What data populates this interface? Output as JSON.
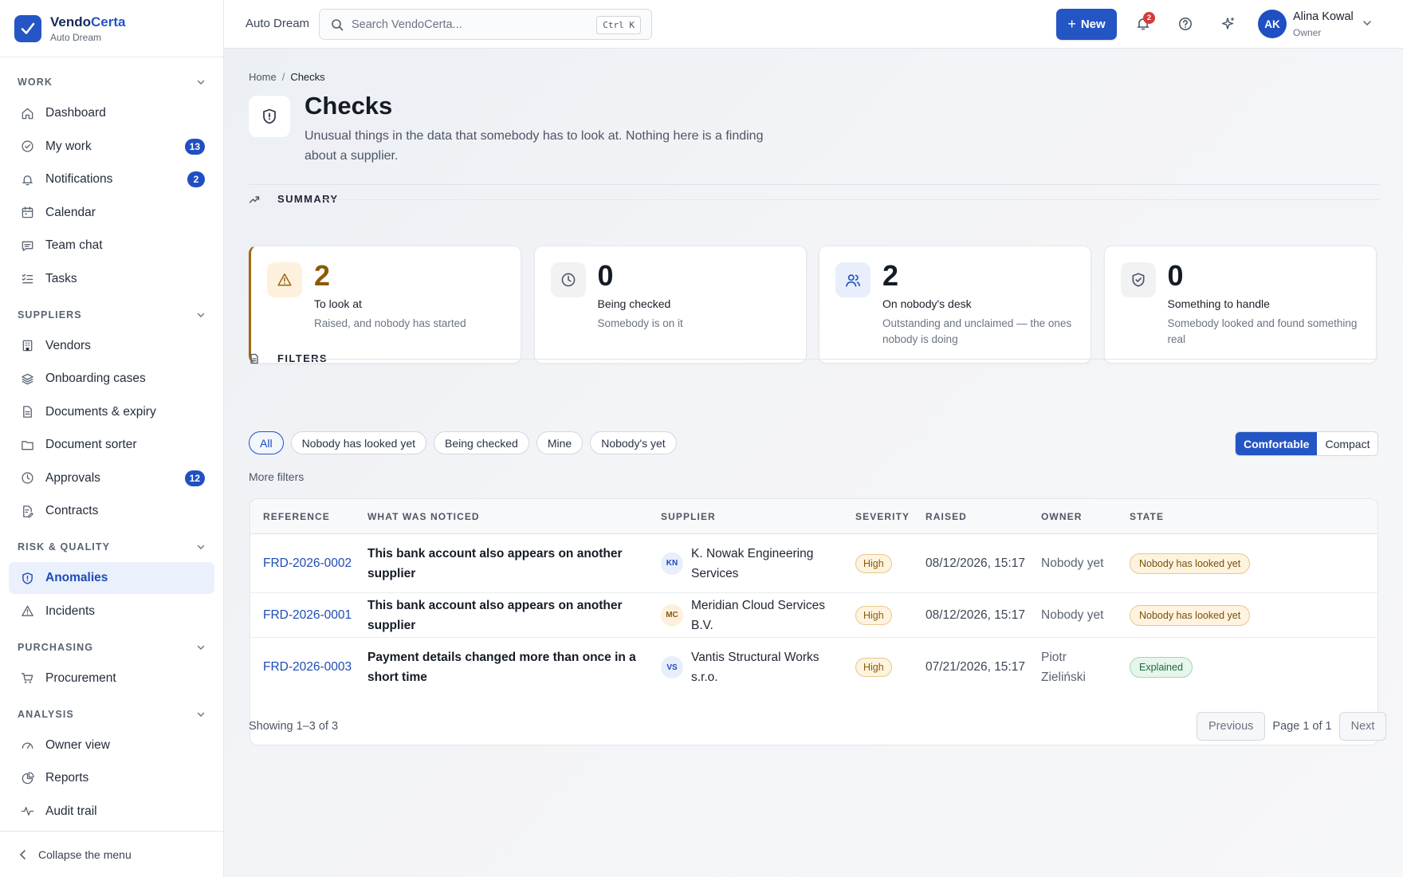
{
  "brand": {
    "name_main": "Vendo",
    "name_accent": "Certa",
    "org": "Auto Dream"
  },
  "sidebar": {
    "groups": [
      {
        "title": "WORK",
        "items": [
          {
            "label": "Dashboard",
            "icon": "home-icon"
          },
          {
            "label": "My work",
            "icon": "check-circle-icon",
            "badge": "13"
          },
          {
            "label": "Notifications",
            "icon": "bell-icon",
            "badge": "2"
          },
          {
            "label": "Calendar",
            "icon": "calendar-icon"
          },
          {
            "label": "Team chat",
            "icon": "chat-icon"
          },
          {
            "label": "Tasks",
            "icon": "list-check-icon"
          }
        ]
      },
      {
        "title": "SUPPLIERS",
        "items": [
          {
            "label": "Vendors",
            "icon": "building-icon"
          },
          {
            "label": "Onboarding cases",
            "icon": "layers-icon"
          },
          {
            "label": "Documents & expiry",
            "icon": "document-icon"
          },
          {
            "label": "Document sorter",
            "icon": "folder-icon"
          },
          {
            "label": "Approvals",
            "icon": "clock-icon",
            "badge": "12"
          },
          {
            "label": "Contracts",
            "icon": "contract-icon"
          }
        ]
      },
      {
        "title": "RISK & QUALITY",
        "items": [
          {
            "label": "Anomalies",
            "icon": "shield-icon",
            "active": true
          },
          {
            "label": "Incidents",
            "icon": "warning-icon"
          }
        ]
      },
      {
        "title": "PURCHASING",
        "items": [
          {
            "label": "Procurement",
            "icon": "cart-icon"
          }
        ]
      },
      {
        "title": "ANALYSIS",
        "items": [
          {
            "label": "Owner view",
            "icon": "gauge-icon"
          },
          {
            "label": "Reports",
            "icon": "pie-icon"
          },
          {
            "label": "Audit trail",
            "icon": "activity-icon"
          }
        ]
      }
    ],
    "collapse_label": "Collapse the menu"
  },
  "topbar": {
    "workspace": "Auto Dream",
    "search_placeholder": "Search VendoCerta...",
    "search_shortcut": "Ctrl K",
    "new_label": "New",
    "notification_count": "2",
    "user": {
      "initials": "AK",
      "name": "Alina Kowal",
      "role": "Owner"
    }
  },
  "page": {
    "breadcrumb": {
      "home": "Home",
      "current": "Checks"
    },
    "title": "Checks",
    "description": "Unusual things in the data that somebody has to look at. Nothing here is a finding about a supplier."
  },
  "summary": {
    "title": "SUMMARY",
    "cards": [
      {
        "value": "2",
        "label": "To look at",
        "sub": "Raised, and nobody has started",
        "icon": "warning-icon",
        "color": "#9a6a16"
      },
      {
        "value": "0",
        "label": "Being checked",
        "sub": "Somebody is on it",
        "icon": "clock-icon",
        "color": "#4d5665"
      },
      {
        "value": "2",
        "label": "On nobody's desk",
        "sub": "Outstanding and unclaimed — the ones nobody is doing",
        "icon": "users-icon",
        "color": "#2455c4"
      },
      {
        "value": "0",
        "label": "Something to handle",
        "sub": "Somebody looked and found something real",
        "icon": "shield-check-icon",
        "color": "#4d5665"
      }
    ]
  },
  "filters": {
    "title": "FILTERS",
    "chips": [
      "All",
      "Nobody has looked yet",
      "Being checked",
      "Mine",
      "Nobody's yet"
    ],
    "active_chip": "All",
    "density": [
      "Comfortable",
      "Compact"
    ],
    "density_selected": "Comfortable",
    "more": "More filters"
  },
  "table": {
    "columns": [
      "REFERENCE",
      "WHAT WAS NOTICED",
      "SUPPLIER",
      "SEVERITY",
      "RAISED",
      "OWNER",
      "STATE"
    ],
    "rows": [
      {
        "reference": "FRD-2026-0002",
        "what": "This bank account also appears on another supplier",
        "supplier_initials": "KN",
        "supplier": "K. Nowak Engineering Services",
        "severity": "High",
        "raised": "08/12/2026, 15:17",
        "owner": "Nobody yet",
        "state": "Nobody has looked yet",
        "state_kind": "warn"
      },
      {
        "reference": "FRD-2026-0001",
        "what": "This bank account also appears on another supplier",
        "supplier_initials": "MC",
        "supplier": "Meridian Cloud Services B.V.",
        "severity": "High",
        "raised": "08/12/2026, 15:17",
        "owner": "Nobody yet",
        "state": "Nobody has looked yet",
        "state_kind": "warn"
      },
      {
        "reference": "FRD-2026-0003",
        "what": "Payment details changed more than once in a short time",
        "supplier_initials": "VS",
        "supplier": "Vantis Structural Works s.r.o.",
        "severity": "High",
        "raised": "07/21/2026, 15:17",
        "owner": "Piotr Zieliński",
        "state": "Explained",
        "state_kind": "ok"
      }
    ],
    "showing": "Showing 1–3 of 3",
    "pagination": {
      "previous": "Previous",
      "info": "Page 1 of 1",
      "next": "Next"
    }
  },
  "colors": {
    "accent": "#2455c4",
    "warning": "#9a6a16",
    "success": "#1d6b3b"
  }
}
